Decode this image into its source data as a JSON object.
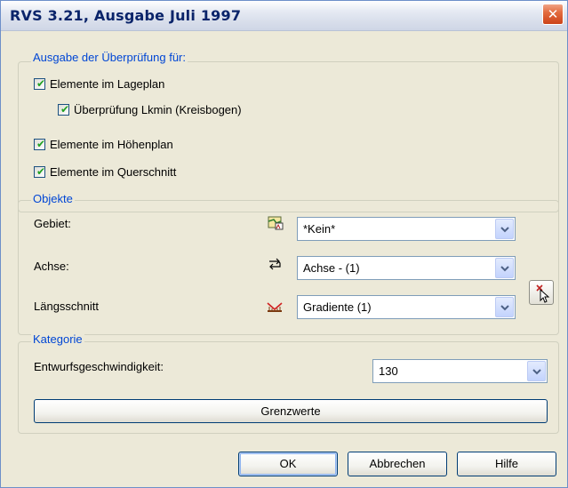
{
  "window": {
    "title": "RVS 3.21, Ausgabe Juli 1997"
  },
  "ausgabe": {
    "legend": "Ausgabe der Überprüfung für:",
    "checks": [
      {
        "label": "Elemente im Lageplan",
        "checked": true
      },
      {
        "label": "Überprüfung Lkmin (Kreisbogen)",
        "checked": true
      },
      {
        "label": "Elemente im Höhenplan",
        "checked": true
      },
      {
        "label": "Elemente im Querschnitt",
        "checked": true
      }
    ]
  },
  "objekte": {
    "legend": "Objekte",
    "gebiet": {
      "label": "Gebiet:",
      "value": "*Kein*",
      "icon": "area-map-icon"
    },
    "achse": {
      "label": "Achse:",
      "value": "Achse - (1)",
      "icon": "axis-arrows-icon"
    },
    "laengsschnitt": {
      "label": "Längsschnitt",
      "value": "Gradiente (1)",
      "icon": "profile-icon"
    }
  },
  "kategorie": {
    "legend": "Kategorie",
    "speed_label": "Entwurfsgeschwindigkeit:",
    "speed_value": "130",
    "limits_button": "Grenzwerte"
  },
  "buttons": {
    "ok": "OK",
    "cancel": "Abbrechen",
    "help": "Hilfe"
  },
  "colors": {
    "legend": "#0046d5",
    "dialog_bg": "#ece9d8",
    "check": "#21a121",
    "close": "#e36c3f"
  }
}
